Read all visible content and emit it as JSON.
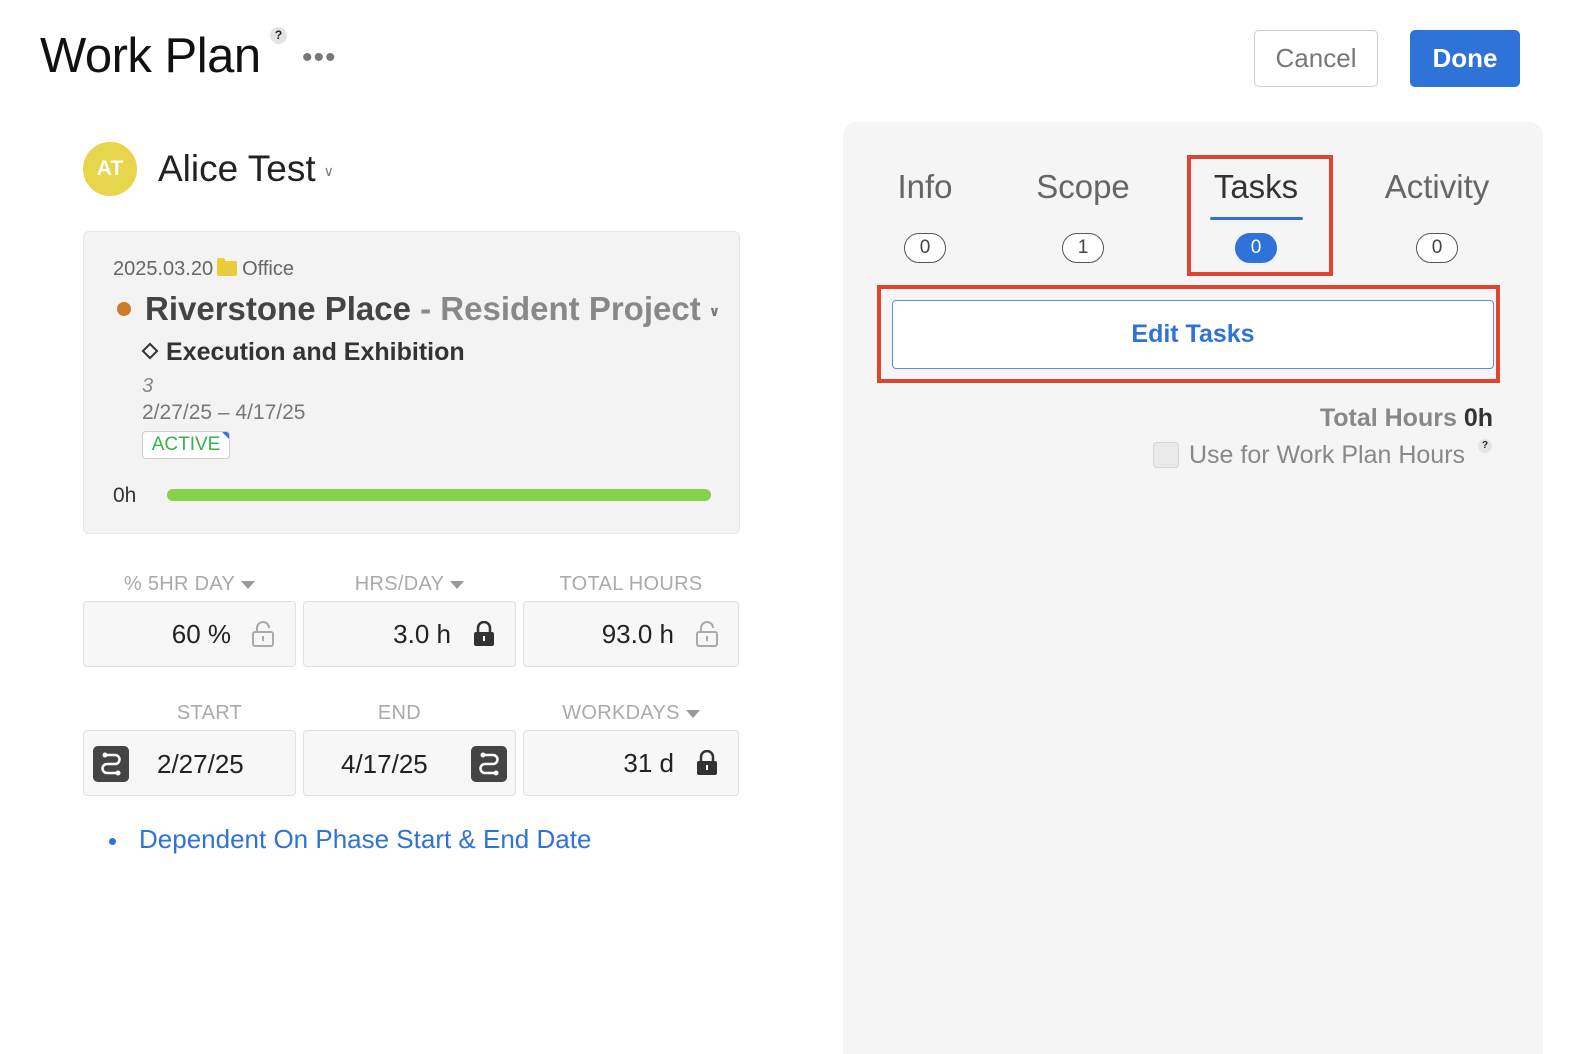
{
  "header": {
    "title": "Work Plan",
    "help": "?",
    "menu": "•••",
    "cancel_label": "Cancel",
    "done_label": "Done"
  },
  "member": {
    "initials": "AT",
    "name": "Alice Test",
    "avatar_color": "#e7d54c"
  },
  "project": {
    "date": "2025.03.20",
    "folder": "Office",
    "name": "Riverstone Place",
    "sub": "- Resident Project",
    "phase": "Execution and Exhibition",
    "phase_number": "3",
    "dates": "2/27/25 – 4/17/25",
    "status": "ACTIVE",
    "hours_label": "0h",
    "progress_fraction": 1.0,
    "dot_color": "#d07a2c",
    "status_color": "#37b24d"
  },
  "fields": {
    "pct_label": "% 5HR DAY",
    "pct_value": "60 %",
    "hrs_label": "HRS/DAY",
    "hrs_value": "3.0 h",
    "total_label": "TOTAL HOURS",
    "total_value": "93.0 h",
    "start_label": "START",
    "start_value": "2/27/25",
    "end_label": "END",
    "end_value": "4/17/25",
    "workdays_label": "WORKDAYS",
    "workdays_value": "31 d"
  },
  "dependency_link": "Dependent On Phase Start & End Date",
  "panel": {
    "tabs": [
      {
        "label": "Info",
        "count": "0"
      },
      {
        "label": "Scope",
        "count": "1"
      },
      {
        "label": "Tasks",
        "count": "0"
      },
      {
        "label": "Activity",
        "count": "0"
      }
    ],
    "active_tab": "Tasks",
    "edit_tasks_label": "Edit Tasks",
    "total_hours_label": "Total Hours",
    "total_hours_value": "0h",
    "use_for_label": "Use for Work Plan Hours",
    "use_for_help": "?",
    "accent_color": "#2f73d9",
    "highlight_color": "#e0432f"
  }
}
